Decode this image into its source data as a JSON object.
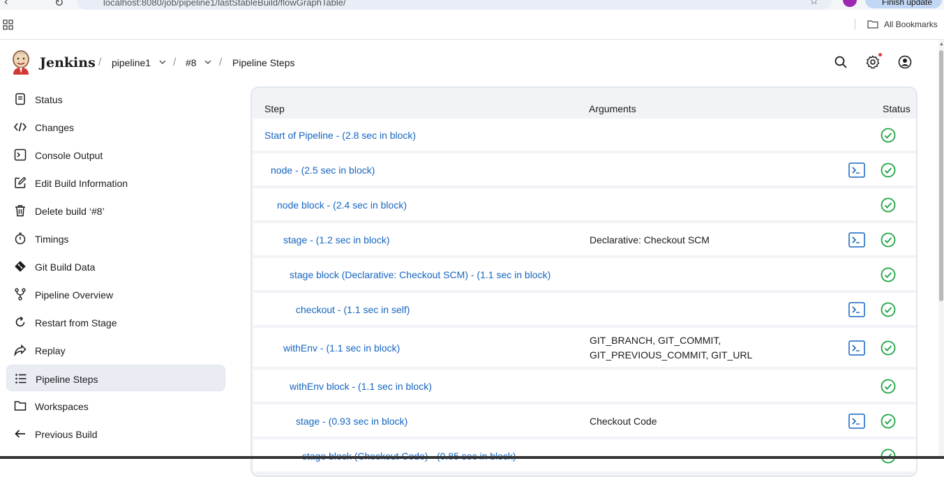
{
  "browser": {
    "url": "localhost:8080/job/pipeline1/lastStableBuild/flowGraphTable/",
    "update_button": "Finish update",
    "all_bookmarks": "All Bookmarks"
  },
  "header": {
    "brand": "Jenkins",
    "breadcrumbs": [
      "pipeline1",
      "#8",
      "Pipeline Steps"
    ]
  },
  "sidebar": {
    "items": [
      {
        "label": "Status",
        "icon": "notepad-icon"
      },
      {
        "label": "Changes",
        "icon": "code-icon"
      },
      {
        "label": "Console Output",
        "icon": "terminal-icon"
      },
      {
        "label": "Edit Build Information",
        "icon": "edit-icon"
      },
      {
        "label": "Delete build ‘#8’",
        "icon": "trash-icon"
      },
      {
        "label": "Timings",
        "icon": "stopwatch-icon"
      },
      {
        "label": "Git Build Data",
        "icon": "git-icon"
      },
      {
        "label": "Pipeline Overview",
        "icon": "branch-icon"
      },
      {
        "label": "Restart from Stage",
        "icon": "restart-icon"
      },
      {
        "label": "Replay",
        "icon": "replay-icon"
      },
      {
        "label": "Pipeline Steps",
        "icon": "list-icon",
        "active": true
      },
      {
        "label": "Workspaces",
        "icon": "folder-icon"
      },
      {
        "label": "Previous Build",
        "icon": "arrow-left-icon"
      }
    ]
  },
  "table": {
    "columns": [
      "Step",
      "Arguments",
      "Status"
    ],
    "rows": [
      {
        "step": "Start of Pipeline - (2.8 sec in block)",
        "args": "",
        "console": false,
        "status": "success"
      },
      {
        "step": "node - (2.5 sec in block)",
        "args": "",
        "console": true,
        "status": "success"
      },
      {
        "step": "node block - (2.4 sec in block)",
        "args": "",
        "console": false,
        "status": "success"
      },
      {
        "step": "stage - (1.2 sec in block)",
        "args": "Declarative: Checkout SCM",
        "console": true,
        "status": "success"
      },
      {
        "step": "stage block (Declarative: Checkout SCM) - (1.1 sec in block)",
        "args": "",
        "console": false,
        "status": "success"
      },
      {
        "step": "checkout - (1.1 sec in self)",
        "args": "",
        "console": true,
        "status": "success"
      },
      {
        "step": "withEnv - (1.1 sec in block)",
        "args": "GIT_BRANCH, GIT_COMMIT, GIT_PREVIOUS_COMMIT, GIT_URL",
        "console": true,
        "status": "success"
      },
      {
        "step": "withEnv block - (1.1 sec in block)",
        "args": "",
        "console": false,
        "status": "success"
      },
      {
        "step": "stage - (0.93 sec in block)",
        "args": "Checkout Code",
        "console": true,
        "status": "success"
      },
      {
        "step": "stage block (Checkout Code) - (0.85 sec in block)",
        "args": "",
        "console": false,
        "status": "success"
      }
    ]
  },
  "colors": {
    "link": "#1565c0",
    "success": "#1ea446",
    "active_bg": "#e9ecf3"
  }
}
